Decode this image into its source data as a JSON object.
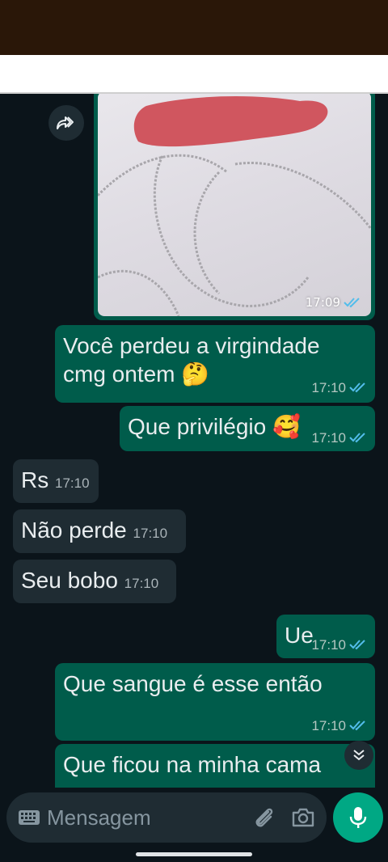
{
  "colors": {
    "status_bar": "#2a1708",
    "chat_bg": "#0b141a",
    "outgoing_bubble": "#005c4b",
    "incoming_bubble": "#1f2c33",
    "read_ticks": "#53bdeb",
    "mic_button": "#00a884"
  },
  "icons": {
    "forward": "forward-icon",
    "ticks": "double-check-icon",
    "keyboard": "keyboard-icon",
    "attach": "paperclip-icon",
    "camera": "camera-icon",
    "mic": "microphone-icon",
    "scroll": "chevron-double-down-icon"
  },
  "image_message": {
    "time": "17:09",
    "status": "read"
  },
  "messages": [
    {
      "direction": "out",
      "text": "Você perdeu a virgindade cmg ontem 🤔",
      "time": "17:10",
      "status": "read"
    },
    {
      "direction": "out",
      "text": "Que privilégio 🥰",
      "time": "17:10",
      "status": "read"
    },
    {
      "direction": "in",
      "text": "Rs",
      "time": "17:10"
    },
    {
      "direction": "in",
      "text": "Não perde",
      "time": "17:10"
    },
    {
      "direction": "in",
      "text": "Seu bobo",
      "time": "17:10"
    },
    {
      "direction": "out",
      "text": "Ue",
      "time": "17:10",
      "status": "read"
    },
    {
      "direction": "out",
      "text": "Que sangue é esse então",
      "time": "17:10",
      "status": "read"
    },
    {
      "direction": "out",
      "text": "Que ficou na minha cama",
      "time": "",
      "status": ""
    }
  ],
  "composer": {
    "placeholder": "Mensagem"
  }
}
